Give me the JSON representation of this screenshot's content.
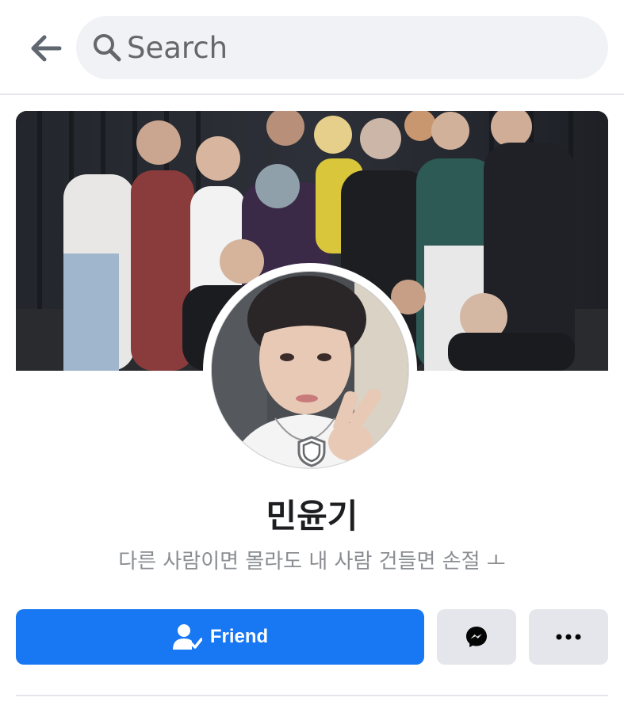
{
  "search": {
    "placeholder": "Search"
  },
  "icons": {
    "back": "back-arrow-icon",
    "search": "search-icon",
    "shield": "shield-icon",
    "friend": "friend-check-icon",
    "messenger": "messenger-icon",
    "more": "more-dots-icon"
  },
  "profile": {
    "name": "민윤기",
    "bio": "다른 사람이면 몰라도 내 사람 건들면 손절 ㅗ"
  },
  "actions": {
    "friend_label": "Friend"
  },
  "colors": {
    "primary": "#1877f2",
    "secondary_button": "#e4e6eb",
    "search_bg": "#f0f2f5",
    "text_primary": "#1c1e21",
    "text_secondary": "#8a8d91"
  }
}
